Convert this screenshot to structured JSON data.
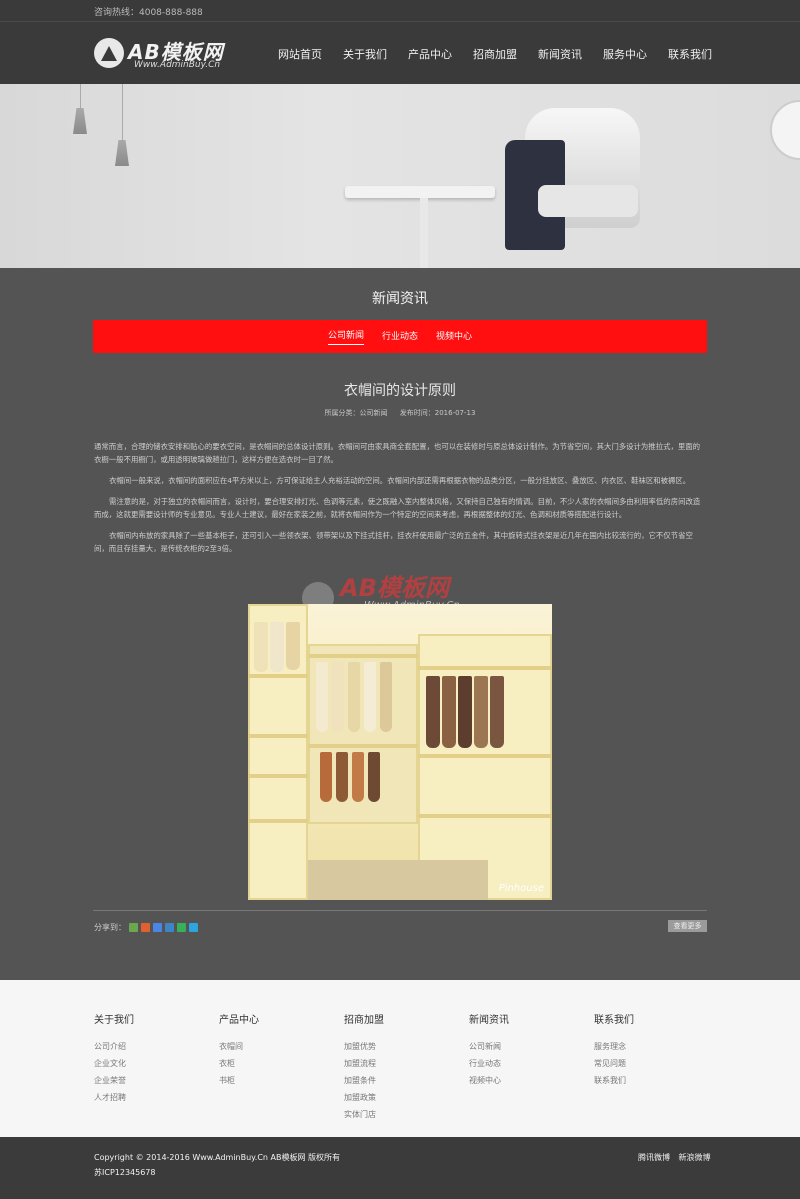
{
  "topbar": {
    "hotline": "咨询热线：4008-888-888"
  },
  "header": {
    "logo_text": "AB模板网",
    "logo_sub": "Www.AdminBuy.Cn",
    "nav": [
      "网站首页",
      "关于我们",
      "产品中心",
      "招商加盟",
      "新闻资讯",
      "服务中心",
      "联系我们"
    ]
  },
  "section": {
    "title": "新闻资讯",
    "subnav": [
      "公司新闻",
      "行业动态",
      "视频中心"
    ],
    "active_subnav": "公司新闻"
  },
  "article": {
    "title": "衣帽间的设计原则",
    "category": "所属分类：公司新闻",
    "date": "发布时间：2016-07-13",
    "paragraphs": [
      "通常而言，合理的储衣安排和贴心的要衣空间，是衣帽间的总体设计原则。衣帽间可由家具商全套配置，也可以在装修时与原总体设计制作。为节省空间，其大门多设计为推拉式，里面的衣橱一般不用橱门，或用透明玻璃做趟拉门，这样方便在选衣时一目了然。",
      "衣帽间一般来说，衣帽间的面积应在4平方米以上，方可保证给主人充裕活动的空间。衣帽间内部还需再根据衣物的品类分区，一般分挂放区、叠放区、内衣区、鞋袜区和被褥区。",
      "需注意的是，对于独立的衣帽间而言，设计时，要合理安排灯光、色调等元素，使之既融入室内整体风格，又保持自己独有的情调。目前，不少人家的衣帽间多由利用率低的房间改造而成，这就更需要设计师的专业意见。专业人士建议，最好在家装之前，就将衣帽间作为一个特定的空间来考虑，再根据整体的灯光、色调和材质等搭配进行设计。",
      "衣帽间内布放的家具除了一些基本柜子，还可引入一些领衣架、领带架以及下挂式挂杆，挂衣杆使用最广泛的五金件，其中旋转式挂衣架是近几年在国内比较流行的，它不仅节省空间，而且存挂量大，是传统衣柜的2至3倍。"
    ],
    "photo_caption": "Pinhouse"
  },
  "watermark": {
    "text": "AB模板网",
    "sub": "Www.AdminBuy.Cn"
  },
  "share": {
    "label": "分享到："
  },
  "back_button": "查看更多",
  "footer": {
    "columns": [
      {
        "title": "关于我们",
        "links": [
          "公司介绍",
          "企业文化",
          "企业荣誉",
          "人才招聘"
        ]
      },
      {
        "title": "产品中心",
        "links": [
          "衣帽间",
          "衣柜",
          "书柜"
        ]
      },
      {
        "title": "招商加盟",
        "links": [
          "加盟优势",
          "加盟流程",
          "加盟条件",
          "加盟政策",
          "实体门店"
        ]
      },
      {
        "title": "新闻资讯",
        "links": [
          "公司新闻",
          "行业动态",
          "视频中心"
        ]
      },
      {
        "title": "联系我们",
        "links": [
          "服务理念",
          "常见问题",
          "联系我们"
        ]
      }
    ]
  },
  "bottom": {
    "copyright": "Copyright © 2014-2016 Www.AdminBuy.Cn AB模板网 版权所有",
    "icp": "苏ICP12345678",
    "links": [
      "腾讯微博",
      "新浪微博"
    ]
  },
  "colors": {
    "accent_red": "#ff0f0f",
    "body_bg": "#545454",
    "header_bg": "#3a3a3a",
    "footer_bg": "#f6f6f6"
  }
}
